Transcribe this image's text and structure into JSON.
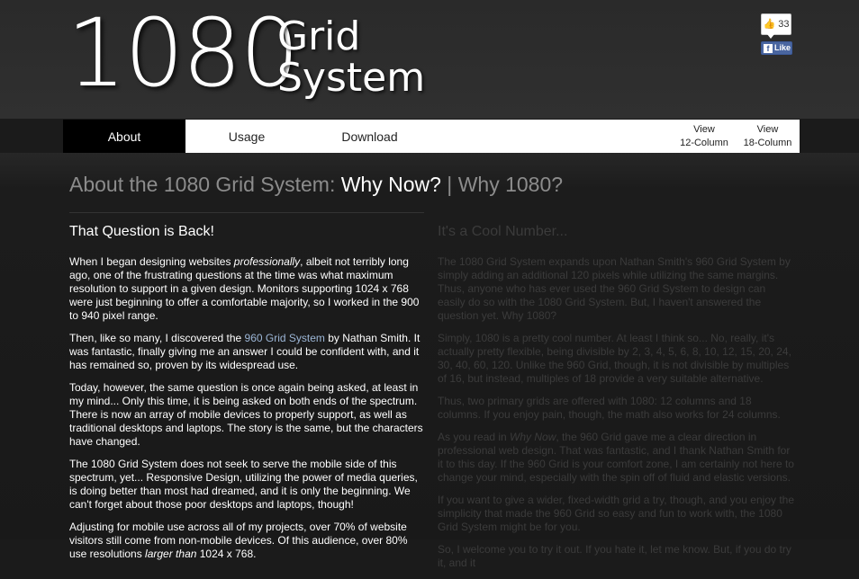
{
  "header": {
    "logo_number": "1080",
    "logo_word1": "Grid",
    "logo_word2": "System",
    "like_count": "33",
    "like_label": "Like"
  },
  "nav": {
    "items": [
      "About",
      "Usage",
      "Download"
    ],
    "view12_line1": "View",
    "view12_line2": "12-Column",
    "view18_line1": "View",
    "view18_line2": "18-Column"
  },
  "headline": {
    "prefix": "About the 1080 Grid System: ",
    "current": "Why Now?",
    "sep": " | ",
    "other": "Why 1080?"
  },
  "left": {
    "title": "That Question is Back!",
    "p1_a": "When I began designing websites ",
    "p1_em": "professionally",
    "p1_b": ", albeit not terribly long ago, one of the frustrating questions at the time was what maximum resolution to support in a given design. Monitors supporting 1024 x 768 were just beginning to offer a comfortable majority, so I worked in the 900 to 940 pixel range.",
    "p2_a": "Then, like so many, I discovered the ",
    "p2_link": "960 Grid System",
    "p2_b": " by Nathan Smith. It was fantastic, finally giving me an answer I could be confident with, and it has remained so, proven by its widespread use.",
    "p3": "Today, however, the same question is once again being asked, at least in my mind... Only this time, it is being asked on both ends of the spectrum. There is now an array of mobile devices to properly support, as well as traditional desktops and laptops. The story is the same, but the characters have changed.",
    "p4": "The 1080 Grid System does not seek to serve the mobile side of this spectrum, yet... Responsive Design, utilizing the power of media queries, is doing better than most had dreamed, and it is only the beginning. We can't forget about those poor desktops and laptops, though!",
    "p5_a": "Adjusting for mobile use across all of my projects, over 70% of website visitors still come from non-mobile devices. Of this audience, over 80% use resolutions ",
    "p5_em": "larger than",
    "p5_b": " 1024 x 768."
  },
  "right": {
    "title": "It's a Cool Number...",
    "p1": "The 1080 Grid System expands upon Nathan Smith's 960 Grid System by simply adding an additional 120 pixels while utilizing the same margins. Thus, anyone who has ever used the 960 Grid System to design can easily do so with the 1080 Grid System. But, I haven't answered the question yet. Why 1080?",
    "p2": "Simply, 1080 is a pretty cool number. At least I think so... No, really, it's actually pretty flexible, being divisible by 2, 3, 4, 5, 6, 8, 10, 12, 15, 20, 24, 30, 40, 60, 120. Unlike the 960 Grid, though, it is not divisible by multiples of 16, but instead, multiples of 18 provide a very suitable alternative.",
    "p3": "Thus, two primary grids are offered with 1080: 12 columns and 18 columns. If you enjoy pain, though, the math also works for 24 columns.",
    "p4_a": "As you read in ",
    "p4_em": "Why Now",
    "p4_b": ", the 960 Grid gave me a clear direction in professional web design. That was fantastic, and I thank Nathan Smith for it to this day. If the 960 Grid is your comfort zone, I am certainly not here to change your mind, especially with the spin off of fluid and elastic versions.",
    "p5": "If you want to give a wider, fixed-width grid a try, though, and you enjoy the simplicity that made the 960 Grid so easy and fun to work with, the 1080 Grid System might be for you.",
    "p6": "So, I welcome you to try it out. If you hate it, let me know. But, if you do try it, and it"
  },
  "colors": {
    "background": "#1b1b1b",
    "nav_active": "#000000",
    "link": "#9cb6d6",
    "facebook": "#4a66a0"
  }
}
